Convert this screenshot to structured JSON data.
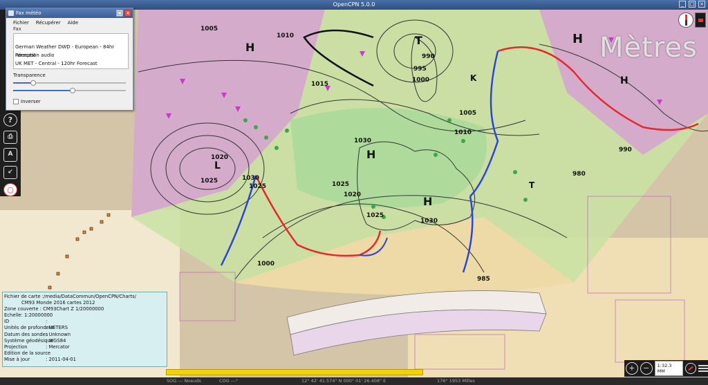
{
  "window": {
    "title": "OpenCPN 5.0.0"
  },
  "units_overlay": "Mètres",
  "fax_dialog": {
    "title": "Fax météo",
    "menus": [
      "Fichier",
      "Récupérer",
      "Aide"
    ],
    "menu_label": "Fax",
    "list_items": [
      "German Weather DWD - European - 84hr Forecast",
      "Réception audio",
      "UK MET - Central - 120hr Forecast"
    ],
    "transparency_label": "Transparence",
    "transparency_level": 0.18,
    "second_slider_level": 0.53,
    "invert_label": "Inverser"
  },
  "chart_info": {
    "rows": [
      {
        "label": "Fichier de carte :",
        "value": "/media/DataCommun/OpenCPN/Charts/"
      },
      {
        "label": "",
        "value": "CM93 Monde 2016 cartes 2012"
      },
      {
        "label": "Zone couverte :",
        "value": "CM93Chart Z  1/20000000"
      },
      {
        "label": "Echelle:",
        "value": "1:20000000"
      },
      {
        "label": "ID",
        "value": ":"
      },
      {
        "label": "Unités de profondeur",
        "value": ": METERS"
      },
      {
        "label": "Datum des sondes",
        "value": ": Unknown"
      },
      {
        "label": "Système géodésique",
        "value": ": WGS84"
      },
      {
        "label": "Projection",
        "value": ": Mercator"
      },
      {
        "label": "Edition de la source",
        "value": ":"
      },
      {
        "label": "Mise à jour",
        "value": ": 2011-04-01"
      }
    ]
  },
  "scale_readout": "1:32.3 MM",
  "status": {
    "sog": "SOG --- Noeuds",
    "cog": "COG ---°",
    "position": "12° 42' 41.574\" N   000° 01' 26.408\" E",
    "bearing_distance": "176°  1953 Milles"
  },
  "isobar_labels": [
    "1005",
    "1010",
    "1015",
    "990",
    "995",
    "1000",
    "1005",
    "1010",
    "1025",
    "1030",
    "1020",
    "1025",
    "1030",
    "1025",
    "1020",
    "1025",
    "1030",
    "1000",
    "980",
    "990",
    "985"
  ],
  "map_colors": {
    "front_warm": "#e8262b",
    "front_cold": "#2a45d8",
    "sea": "#d9cdb5",
    "land_green": "#8fd07a",
    "land_pink": "#e6a6e6"
  }
}
